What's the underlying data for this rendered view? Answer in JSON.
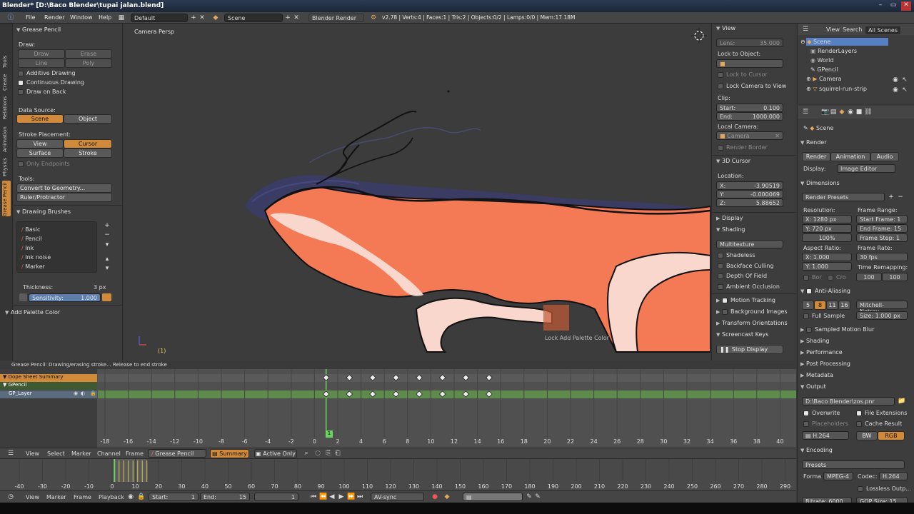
{
  "window": {
    "title": "Blender* [D:\\Baco Blender\\tupai jalan.blend]",
    "minimize": "–",
    "maximize": "▭",
    "close": "✕"
  },
  "menubar": {
    "info_icon": "info-icon",
    "items": [
      "File",
      "Render",
      "Window",
      "Help"
    ],
    "screen": "Default",
    "scene": "Scene",
    "engine": "Blender Render",
    "stats": "v2.78 | Verts:4 | Faces:1 | Tris:2 | Objects:0/2 | Lamps:0/0 | Mem:17.18M"
  },
  "toolshelf": {
    "tabs": [
      "Tools",
      "Create",
      "Relations",
      "Animation",
      "Physics",
      "Grease Pencil"
    ],
    "panel_title": "Grease Pencil",
    "draw_label": "Draw:",
    "draw_buttons": [
      "Draw",
      "Erase",
      "Line",
      "Poly"
    ],
    "additive": "Additive Drawing",
    "continuous": "Continuous Drawing",
    "draw_on_back": "Draw on Back",
    "data_source_label": "Data Source:",
    "data_source": [
      "Scene",
      "Object"
    ],
    "stroke_placement_label": "Stroke Placement:",
    "placement": [
      "View",
      "Cursor",
      "Surface",
      "Stroke"
    ],
    "only_endpoints": "Only Endpoints",
    "tools_label": "Tools:",
    "tools": [
      "Convert to Geometry...",
      "Ruler/Protractor"
    ],
    "brushes_title": "Drawing Brushes",
    "brushes": [
      "Basic",
      "Pencil",
      "Ink",
      "Ink noise",
      "Marker"
    ],
    "thickness_label": "Thickness:",
    "thickness_value": "3 px",
    "sensitivity_label": "Sensitivity:",
    "sensitivity_value": "1.000",
    "add_palette": "Add Palette Color"
  },
  "viewport": {
    "label": "Camera Persp",
    "frame": "(1)",
    "tooltip": "Lock Add Palette Color"
  },
  "npanel": {
    "view_title": "View",
    "lens_label": "Lens:",
    "lens_value": "35.000",
    "lock_to_object": "Lock to Object:",
    "lock_to_cursor": "Lock to Cursor",
    "lock_camera": "Lock Camera to View",
    "clip_label": "Clip:",
    "clip_start_label": "Start:",
    "clip_start": "0.100",
    "clip_end_label": "End:",
    "clip_end": "1000.000",
    "local_camera": "Local Camera:",
    "camera_field": "Camera",
    "render_border": "Render Border",
    "cursor_title": "3D Cursor",
    "location": "Location:",
    "x_label": "X:",
    "x_value": "-3.90519",
    "y_label": "Y:",
    "y_value": "-0.000069",
    "z_label": "Z:",
    "z_value": "5.88652",
    "display_title": "Display",
    "shading_title": "Shading",
    "shading_mode": "Multitexture",
    "shading_options": [
      "Shadeless",
      "Backface Culling",
      "Depth Of Field",
      "Ambient Occlusion"
    ],
    "motion_tracking": "Motion Tracking",
    "background_images": "Background Images",
    "transform_orientations": "Transform Orientations",
    "screencast_keys": "Screencast Keys",
    "stop_display": "Stop Display"
  },
  "outliner": {
    "menus": [
      "View",
      "Search",
      "All Scenes"
    ],
    "items": [
      {
        "name": "Scene",
        "indent": 0
      },
      {
        "name": "RenderLayers",
        "indent": 1
      },
      {
        "name": "World",
        "indent": 1
      },
      {
        "name": "GPencil",
        "indent": 1
      },
      {
        "name": "Camera",
        "indent": 1
      },
      {
        "name": "squirrel-run-strip",
        "indent": 1
      }
    ]
  },
  "properties": {
    "context": "Scene",
    "render_title": "Render",
    "render_buttons": [
      "Render",
      "Animation",
      "Audio"
    ],
    "display_label": "Display:",
    "display_value": "Image Editor",
    "dimensions_title": "Dimensions",
    "render_presets": "Render Presets",
    "resolution_label": "Resolution:",
    "res_x": "X:   1280 px",
    "res_y": "Y:    720 px",
    "res_pct": "100%",
    "frame_range_label": "Frame Range:",
    "start_frame": "Start Frame: 1",
    "end_frame": "End Frame: 15",
    "frame_step": "Frame Step: 1",
    "aspect_label": "Aspect Ratio:",
    "aspect_x": "X:    1.000",
    "aspect_y": "Y:    1.000",
    "frame_rate_label": "Frame Rate:",
    "frame_rate": "30 fps",
    "time_remap_label": "Time Remapping:",
    "remap_old": "100",
    "remap_new": "100",
    "border": "Bor",
    "crop": "Cro",
    "aa_title": "Anti-Aliasing",
    "aa_samples": [
      "5",
      "8",
      "11",
      "16"
    ],
    "aa_filter": "Mitchell-Netrav...",
    "full_sample": "Full Sample",
    "aa_size": "Size: 1.000 px",
    "sampled_motion_blur": "Sampled Motion Blur",
    "shading_title": "Shading",
    "performance_title": "Performance",
    "post_processing_title": "Post Processing",
    "metadata_title": "Metadata",
    "output_title": "Output",
    "output_path": "D:\\Baco Blender\\zos.pnr",
    "overwrite": "Overwrite",
    "file_extensions": "File Extensions",
    "placeholders": "Placeholders",
    "cache_result": "Cache Result",
    "format_value": "H.264",
    "bw": "BW",
    "rgb": "RGB",
    "encoding_title": "Encoding",
    "presets": "Presets",
    "format_label": "Forma",
    "format_container": "MPEG-4",
    "codec_label": "Codec:",
    "codec_value": "H.264",
    "lossless": "Lossless Outp...",
    "bitrate": "Bitrate: 6000",
    "gop": "GOP Size: 15"
  },
  "status_text": "Grease Pencil: Drawing/erasing stroke... Release to end stroke",
  "dopesheet": {
    "channels": [
      {
        "name": "Dope Sheet Summary",
        "type": "summary"
      },
      {
        "name": "GPencil",
        "type": "gp"
      },
      {
        "name": "GP_Layer",
        "type": "layer"
      }
    ],
    "ruler": [
      "-18",
      "-16",
      "-14",
      "-12",
      "-10",
      "-8",
      "-6",
      "-4",
      "-2",
      "0",
      "2",
      "4",
      "6",
      "8",
      "10",
      "12",
      "14",
      "16",
      "18",
      "20",
      "22",
      "24",
      "26",
      "28",
      "30",
      "32",
      "34",
      "36",
      "38",
      "40"
    ],
    "keyframes": [
      1,
      3,
      5,
      7,
      9,
      11,
      13,
      15
    ],
    "current_frame": "1",
    "header_menus": [
      "View",
      "Select",
      "Marker",
      "Channel",
      "Frame"
    ],
    "mode": "Grease Pencil",
    "summary": "Summary",
    "active_only": "Active Only"
  },
  "timeline": {
    "ruler": [
      "-40",
      "-30",
      "-20",
      "-10",
      "0",
      "10",
      "20",
      "30",
      "40",
      "50",
      "60",
      "70",
      "80",
      "90",
      "100",
      "110",
      "120",
      "130",
      "140",
      "150",
      "160",
      "170",
      "180",
      "190",
      "200",
      "210",
      "220",
      "230",
      "240",
      "250",
      "260",
      "270",
      "280",
      "290"
    ],
    "header_menus": [
      "View",
      "Marker",
      "Frame",
      "Playback"
    ],
    "start_label": "Start:",
    "start_value": "1",
    "end_label": "End:",
    "end_value": "15",
    "current": "1",
    "sync": "AV-sync"
  },
  "colors": {
    "accent": "#d08a3a",
    "selection": "#5680c2",
    "squirrel_body": "#f37a54",
    "squirrel_belly": "#f9d7cd",
    "shadow": "#3b3c6e",
    "keyframe_track": "#5e8a4c",
    "playhead": "#6bd35f"
  }
}
